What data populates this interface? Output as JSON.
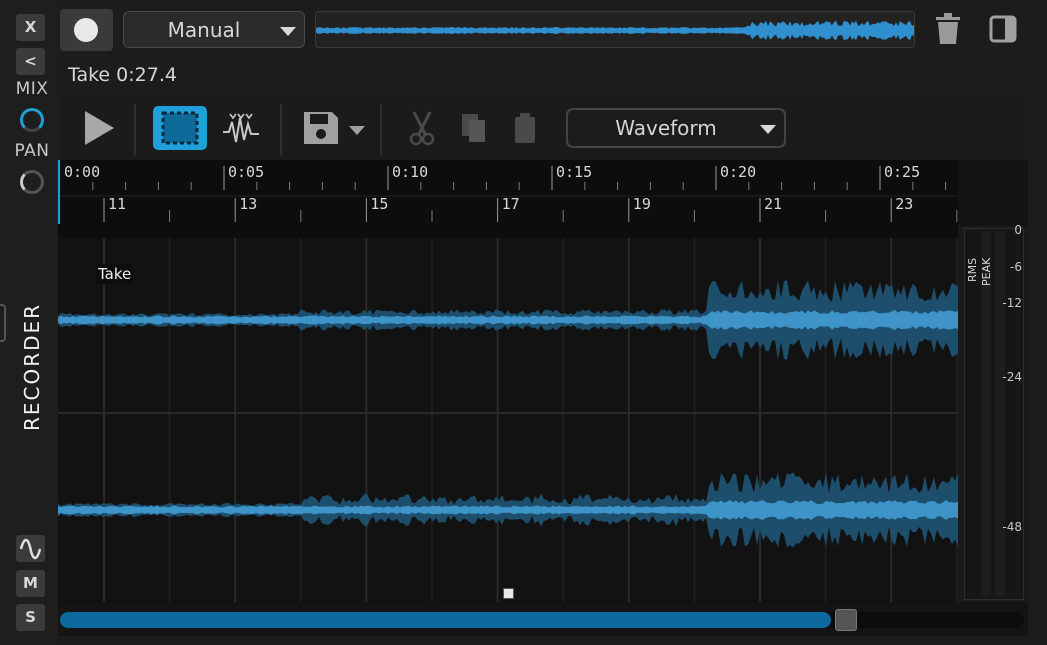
{
  "sidebar": {
    "close_label": "X",
    "collapse_label": "<",
    "mix_label": "MIX",
    "pan_label": "PAN",
    "title": "RECORDER",
    "wave_icon": "sine-wave-icon",
    "mute_label": "M",
    "solo_label": "S"
  },
  "topbar": {
    "record_icon": "record-icon",
    "mode": "Manual",
    "trash_icon": "trash-icon",
    "window_icon": "window-icon"
  },
  "take": {
    "info": "Take 0:27.4",
    "lane_label": "Take"
  },
  "toolbar": {
    "play_icon": "play-icon",
    "select_icon": "select-region-icon",
    "detect_icon": "peak-detect-icon",
    "save_icon": "save-icon",
    "cut_icon": "cut-icon",
    "copy_icon": "copy-icon",
    "paste_icon": "paste-icon",
    "view_mode": "Waveform"
  },
  "ruler": {
    "time_labels": [
      "0:00",
      "0:05",
      "0:10",
      "0:15",
      "0:20",
      "0:25"
    ],
    "bar_labels": [
      "11",
      "13",
      "15",
      "17",
      "19",
      "21",
      "23"
    ]
  },
  "meter": {
    "rms_label": "RMS",
    "peak_label": "PEAK",
    "scale": [
      "0",
      "-6",
      "-12",
      "-24",
      "-48"
    ]
  },
  "scroll": {
    "position_fraction": 0.81
  },
  "colors": {
    "accent": "#1fa0d8",
    "wave_outer": "#1d4e6c",
    "wave_inner": "#3e94c8",
    "scroll_fill": "#0d6aa0"
  }
}
